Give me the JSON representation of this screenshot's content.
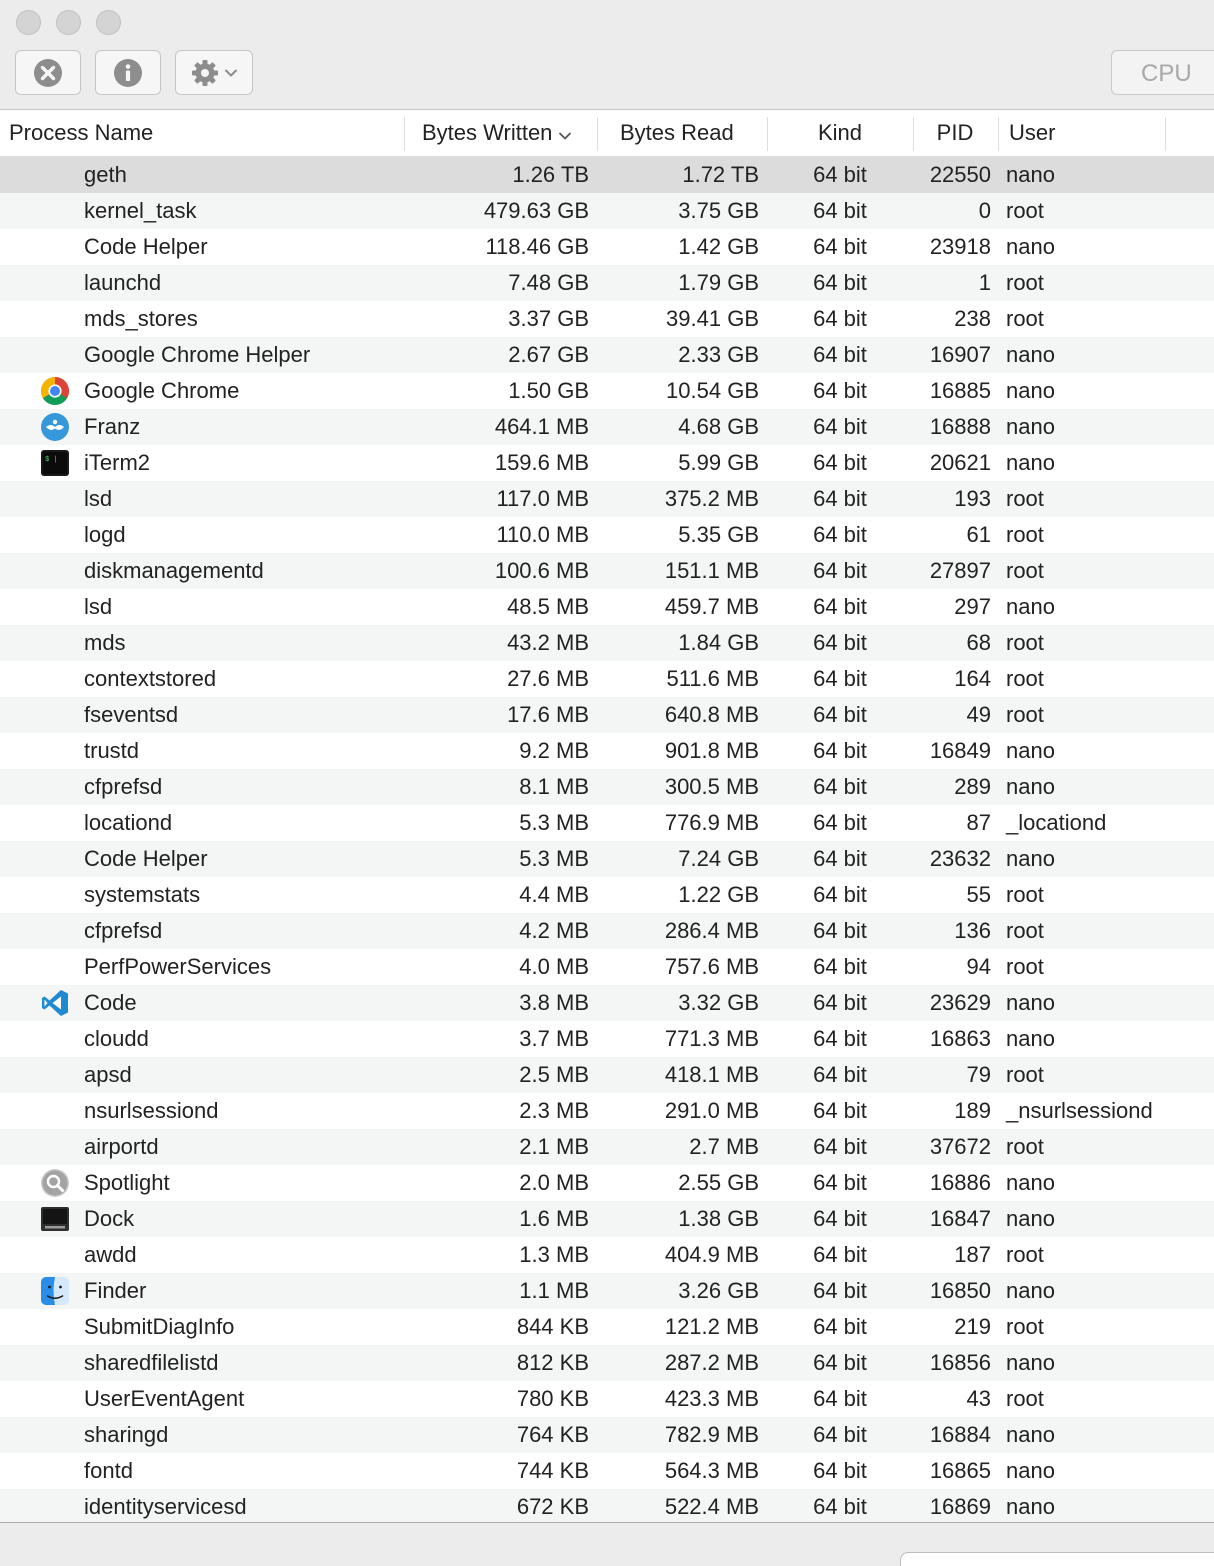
{
  "toolbar": {
    "stop_icon": "x-circle-icon",
    "info_icon": "info-icon",
    "action_icon": "gear-icon",
    "tab_label": "CPU"
  },
  "columns": [
    "Process Name",
    "Bytes Written",
    "Bytes Read",
    "Kind",
    "PID",
    "User"
  ],
  "sort": {
    "column": "Bytes Written",
    "direction": "descending"
  },
  "processes": [
    {
      "name": "geth",
      "bytes_written": "1.26 TB",
      "bytes_read": "1.72 TB",
      "kind": "64 bit",
      "pid": "22550",
      "user": "nano",
      "icon": "",
      "selected": true
    },
    {
      "name": "kernel_task",
      "bytes_written": "479.63 GB",
      "bytes_read": "3.75 GB",
      "kind": "64 bit",
      "pid": "0",
      "user": "root",
      "icon": ""
    },
    {
      "name": "Code Helper",
      "bytes_written": "118.46 GB",
      "bytes_read": "1.42 GB",
      "kind": "64 bit",
      "pid": "23918",
      "user": "nano",
      "icon": ""
    },
    {
      "name": "launchd",
      "bytes_written": "7.48 GB",
      "bytes_read": "1.79 GB",
      "kind": "64 bit",
      "pid": "1",
      "user": "root",
      "icon": ""
    },
    {
      "name": "mds_stores",
      "bytes_written": "3.37 GB",
      "bytes_read": "39.41 GB",
      "kind": "64 bit",
      "pid": "238",
      "user": "root",
      "icon": ""
    },
    {
      "name": "Google Chrome Helper",
      "bytes_written": "2.67 GB",
      "bytes_read": "2.33 GB",
      "kind": "64 bit",
      "pid": "16907",
      "user": "nano",
      "icon": ""
    },
    {
      "name": "Google Chrome",
      "bytes_written": "1.50 GB",
      "bytes_read": "10.54 GB",
      "kind": "64 bit",
      "pid": "16885",
      "user": "nano",
      "icon": "chrome-icon"
    },
    {
      "name": "Franz",
      "bytes_written": "464.1 MB",
      "bytes_read": "4.68 GB",
      "kind": "64 bit",
      "pid": "16888",
      "user": "nano",
      "icon": "franz-icon"
    },
    {
      "name": "iTerm2",
      "bytes_written": "159.6 MB",
      "bytes_read": "5.99 GB",
      "kind": "64 bit",
      "pid": "20621",
      "user": "nano",
      "icon": "iterm-icon"
    },
    {
      "name": "lsd",
      "bytes_written": "117.0 MB",
      "bytes_read": "375.2 MB",
      "kind": "64 bit",
      "pid": "193",
      "user": "root",
      "icon": ""
    },
    {
      "name": "logd",
      "bytes_written": "110.0 MB",
      "bytes_read": "5.35 GB",
      "kind": "64 bit",
      "pid": "61",
      "user": "root",
      "icon": ""
    },
    {
      "name": "diskmanagementd",
      "bytes_written": "100.6 MB",
      "bytes_read": "151.1 MB",
      "kind": "64 bit",
      "pid": "27897",
      "user": "root",
      "icon": ""
    },
    {
      "name": "lsd",
      "bytes_written": "48.5 MB",
      "bytes_read": "459.7 MB",
      "kind": "64 bit",
      "pid": "297",
      "user": "nano",
      "icon": ""
    },
    {
      "name": "mds",
      "bytes_written": "43.2 MB",
      "bytes_read": "1.84 GB",
      "kind": "64 bit",
      "pid": "68",
      "user": "root",
      "icon": ""
    },
    {
      "name": "contextstored",
      "bytes_written": "27.6 MB",
      "bytes_read": "511.6 MB",
      "kind": "64 bit",
      "pid": "164",
      "user": "root",
      "icon": ""
    },
    {
      "name": "fseventsd",
      "bytes_written": "17.6 MB",
      "bytes_read": "640.8 MB",
      "kind": "64 bit",
      "pid": "49",
      "user": "root",
      "icon": ""
    },
    {
      "name": "trustd",
      "bytes_written": "9.2 MB",
      "bytes_read": "901.8 MB",
      "kind": "64 bit",
      "pid": "16849",
      "user": "nano",
      "icon": ""
    },
    {
      "name": "cfprefsd",
      "bytes_written": "8.1 MB",
      "bytes_read": "300.5 MB",
      "kind": "64 bit",
      "pid": "289",
      "user": "nano",
      "icon": ""
    },
    {
      "name": "locationd",
      "bytes_written": "5.3 MB",
      "bytes_read": "776.9 MB",
      "kind": "64 bit",
      "pid": "87",
      "user": "_locationd",
      "icon": ""
    },
    {
      "name": "Code Helper",
      "bytes_written": "5.3 MB",
      "bytes_read": "7.24 GB",
      "kind": "64 bit",
      "pid": "23632",
      "user": "nano",
      "icon": ""
    },
    {
      "name": "systemstats",
      "bytes_written": "4.4 MB",
      "bytes_read": "1.22 GB",
      "kind": "64 bit",
      "pid": "55",
      "user": "root",
      "icon": ""
    },
    {
      "name": "cfprefsd",
      "bytes_written": "4.2 MB",
      "bytes_read": "286.4 MB",
      "kind": "64 bit",
      "pid": "136",
      "user": "root",
      "icon": ""
    },
    {
      "name": "PerfPowerServices",
      "bytes_written": "4.0 MB",
      "bytes_read": "757.6 MB",
      "kind": "64 bit",
      "pid": "94",
      "user": "root",
      "icon": ""
    },
    {
      "name": "Code",
      "bytes_written": "3.8 MB",
      "bytes_read": "3.32 GB",
      "kind": "64 bit",
      "pid": "23629",
      "user": "nano",
      "icon": "vscode-icon"
    },
    {
      "name": "cloudd",
      "bytes_written": "3.7 MB",
      "bytes_read": "771.3 MB",
      "kind": "64 bit",
      "pid": "16863",
      "user": "nano",
      "icon": ""
    },
    {
      "name": "apsd",
      "bytes_written": "2.5 MB",
      "bytes_read": "418.1 MB",
      "kind": "64 bit",
      "pid": "79",
      "user": "root",
      "icon": ""
    },
    {
      "name": "nsurlsessiond",
      "bytes_written": "2.3 MB",
      "bytes_read": "291.0 MB",
      "kind": "64 bit",
      "pid": "189",
      "user": "_nsurlsessiond",
      "icon": ""
    },
    {
      "name": "airportd",
      "bytes_written": "2.1 MB",
      "bytes_read": "2.7 MB",
      "kind": "64 bit",
      "pid": "37672",
      "user": "root",
      "icon": ""
    },
    {
      "name": "Spotlight",
      "bytes_written": "2.0 MB",
      "bytes_read": "2.55 GB",
      "kind": "64 bit",
      "pid": "16886",
      "user": "nano",
      "icon": "spotlight-icon"
    },
    {
      "name": "Dock",
      "bytes_written": "1.6 MB",
      "bytes_read": "1.38 GB",
      "kind": "64 bit",
      "pid": "16847",
      "user": "nano",
      "icon": "dock-icon"
    },
    {
      "name": "awdd",
      "bytes_written": "1.3 MB",
      "bytes_read": "404.9 MB",
      "kind": "64 bit",
      "pid": "187",
      "user": "root",
      "icon": ""
    },
    {
      "name": "Finder",
      "bytes_written": "1.1 MB",
      "bytes_read": "3.26 GB",
      "kind": "64 bit",
      "pid": "16850",
      "user": "nano",
      "icon": "finder-icon"
    },
    {
      "name": "SubmitDiagInfo",
      "bytes_written": "844 KB",
      "bytes_read": "121.2 MB",
      "kind": "64 bit",
      "pid": "219",
      "user": "root",
      "icon": ""
    },
    {
      "name": "sharedfilelistd",
      "bytes_written": "812 KB",
      "bytes_read": "287.2 MB",
      "kind": "64 bit",
      "pid": "16856",
      "user": "nano",
      "icon": ""
    },
    {
      "name": "UserEventAgent",
      "bytes_written": "780 KB",
      "bytes_read": "423.3 MB",
      "kind": "64 bit",
      "pid": "43",
      "user": "root",
      "icon": ""
    },
    {
      "name": "sharingd",
      "bytes_written": "764 KB",
      "bytes_read": "782.9 MB",
      "kind": "64 bit",
      "pid": "16884",
      "user": "nano",
      "icon": ""
    },
    {
      "name": "fontd",
      "bytes_written": "744 KB",
      "bytes_read": "564.3 MB",
      "kind": "64 bit",
      "pid": "16865",
      "user": "nano",
      "icon": ""
    },
    {
      "name": "identityservicesd",
      "bytes_written": "672 KB",
      "bytes_read": "522.4 MB",
      "kind": "64 bit",
      "pid": "16869",
      "user": "nano",
      "icon": ""
    }
  ],
  "colors": {
    "window_chrome": "#ececec",
    "row_alt": "#f4f5f5",
    "row_selected": "#dcdcdc",
    "traffic_light_inactive": "#d4d4d4"
  }
}
